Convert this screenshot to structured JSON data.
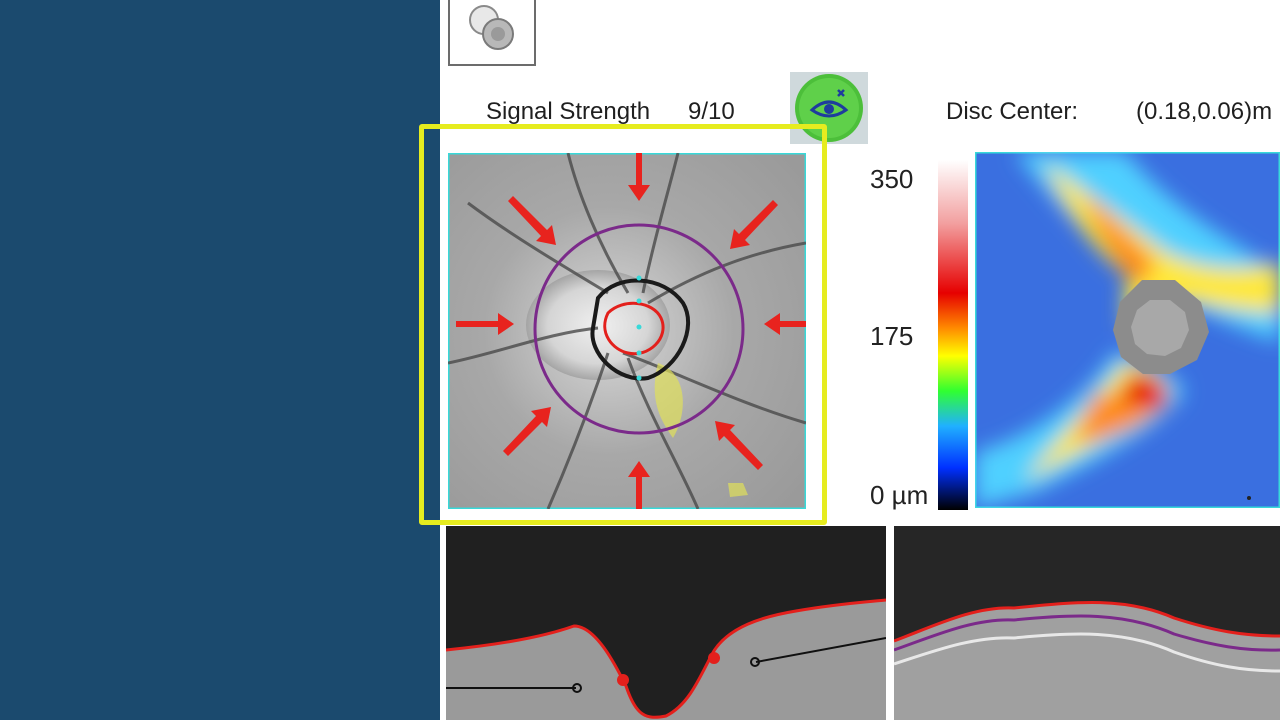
{
  "toolbar": {
    "tool_icon": "compare-circles-icon"
  },
  "header": {
    "signal_label": "Signal Strength",
    "signal_value": "9/10",
    "eye_icon": "eye-tracking-icon",
    "disc_center_label": "Disc Center:",
    "disc_center_value": "(0.18,0.06)m"
  },
  "colorbar": {
    "max_label": "350",
    "mid_label": "175",
    "min_label": "0 µm"
  },
  "colors": {
    "highlight_frame": "#e6ec1f",
    "arrow": "#e8231e",
    "circle": "#7b2a8a",
    "disc_outline": "#1a1a1a",
    "cup_outline": "#e3201c",
    "background_panel": "#1b4a6e"
  }
}
